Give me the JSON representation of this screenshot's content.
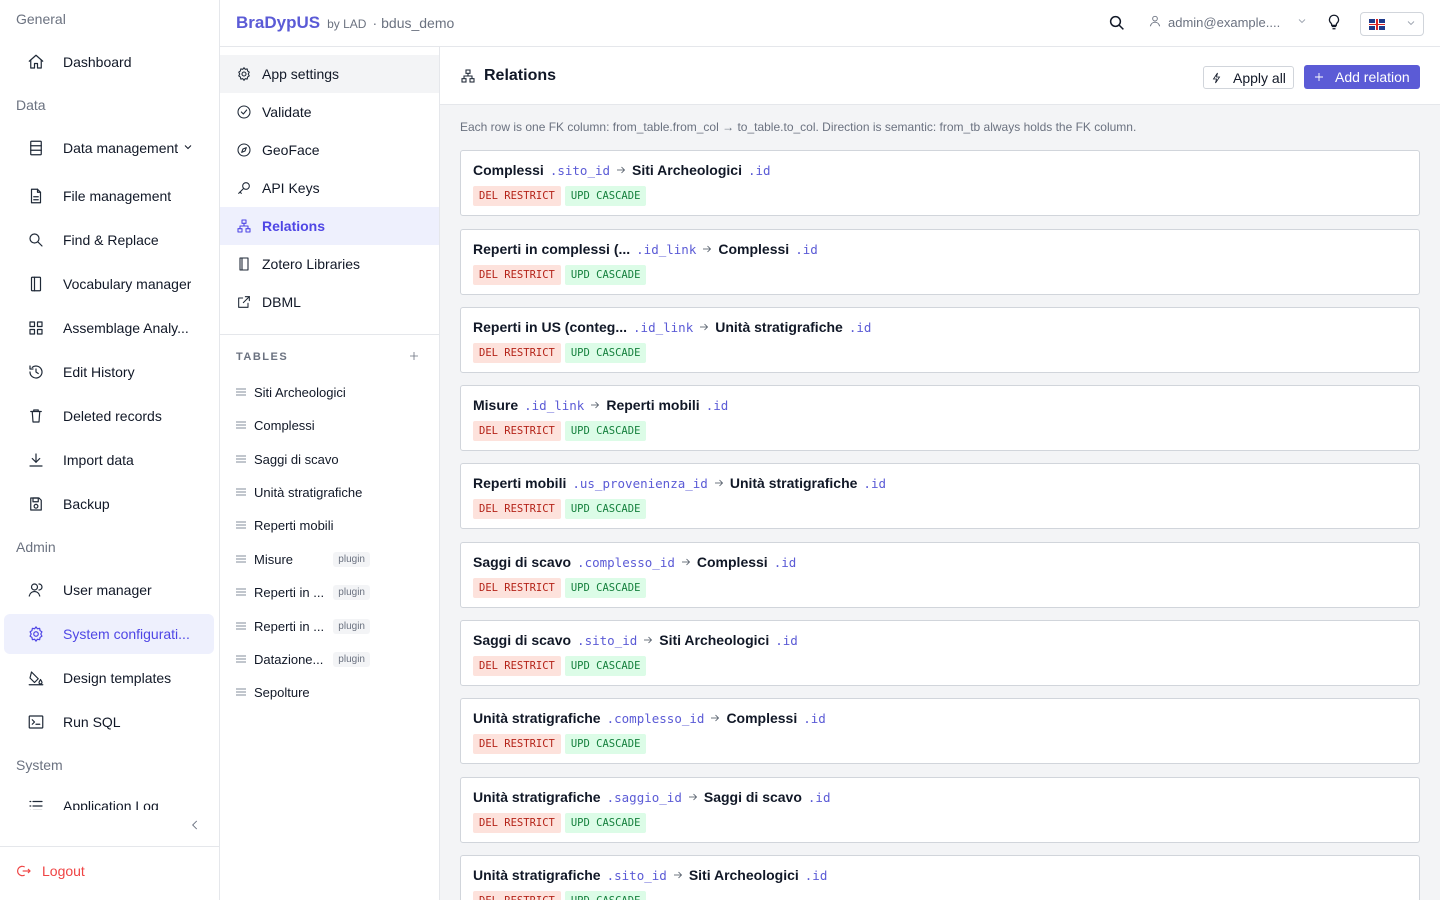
{
  "sidebar": {
    "groups": [
      "General",
      "Data",
      "Admin",
      "System"
    ],
    "items": [
      {
        "label": "Dashboard"
      },
      {
        "label": "Data management"
      },
      {
        "label": "File management"
      },
      {
        "label": "Find & Replace"
      },
      {
        "label": "Vocabulary manager"
      },
      {
        "label": "Assemblage Analy..."
      },
      {
        "label": "Edit History"
      },
      {
        "label": "Deleted records"
      },
      {
        "label": "Import data"
      },
      {
        "label": "Backup"
      },
      {
        "label": "User manager"
      },
      {
        "label": "System configurati..."
      },
      {
        "label": "Design templates"
      },
      {
        "label": "Run SQL"
      },
      {
        "label": "Application Log"
      }
    ],
    "logout": "Logout"
  },
  "header": {
    "brand": "BraDypUS",
    "by": "by LAD",
    "sep": "·",
    "db": "bdus_demo",
    "user": "admin@example...."
  },
  "submenu": {
    "items": [
      {
        "label": "App settings"
      },
      {
        "label": "Validate"
      },
      {
        "label": "GeoFace"
      },
      {
        "label": "API Keys"
      },
      {
        "label": "Relations"
      },
      {
        "label": "Zotero Libraries"
      },
      {
        "label": "DBML"
      }
    ],
    "tables_heading": "TABLES",
    "tables": [
      {
        "name": "Siti Archeologici",
        "badge": ""
      },
      {
        "name": "Complessi",
        "badge": ""
      },
      {
        "name": "Saggi di scavo",
        "badge": ""
      },
      {
        "name": "Unità stratigrafiche",
        "badge": ""
      },
      {
        "name": "Reperti mobili",
        "badge": ""
      },
      {
        "name": "Misure",
        "badge": "plugin"
      },
      {
        "name": "Reperti in ...",
        "badge": "plugin"
      },
      {
        "name": "Reperti in ...",
        "badge": "plugin"
      },
      {
        "name": "Datazione...",
        "badge": "plugin"
      },
      {
        "name": "Sepolture",
        "badge": ""
      }
    ]
  },
  "main": {
    "title": "Relations",
    "apply_all": "Apply all",
    "add_relation": "Add relation",
    "hint": "Each row is one FK column: from_table.from_col → to_table.to_col. Direction is semantic: from_tb always holds the FK column.",
    "relations": [
      {
        "from_tb": "Complessi",
        "from_col": ".sito_id",
        "to_tb": "Siti Archeologici",
        "to_col": ".id",
        "del": "DEL RESTRICT",
        "upd": "UPD CASCADE"
      },
      {
        "from_tb": "Reperti in complessi (...",
        "from_col": ".id_link",
        "to_tb": "Complessi",
        "to_col": ".id",
        "del": "DEL RESTRICT",
        "upd": "UPD CASCADE"
      },
      {
        "from_tb": "Reperti in US (conteg...",
        "from_col": ".id_link",
        "to_tb": "Unità stratigrafiche",
        "to_col": ".id",
        "del": "DEL RESTRICT",
        "upd": "UPD CASCADE"
      },
      {
        "from_tb": "Misure",
        "from_col": ".id_link",
        "to_tb": "Reperti mobili",
        "to_col": ".id",
        "del": "DEL RESTRICT",
        "upd": "UPD CASCADE"
      },
      {
        "from_tb": "Reperti mobili",
        "from_col": ".us_provenienza_id",
        "to_tb": "Unità stratigrafiche",
        "to_col": ".id",
        "del": "DEL RESTRICT",
        "upd": "UPD CASCADE"
      },
      {
        "from_tb": "Saggi di scavo",
        "from_col": ".complesso_id",
        "to_tb": "Complessi",
        "to_col": ".id",
        "del": "DEL RESTRICT",
        "upd": "UPD CASCADE"
      },
      {
        "from_tb": "Saggi di scavo",
        "from_col": ".sito_id",
        "to_tb": "Siti Archeologici",
        "to_col": ".id",
        "del": "DEL RESTRICT",
        "upd": "UPD CASCADE"
      },
      {
        "from_tb": "Unità stratigrafiche",
        "from_col": ".complesso_id",
        "to_tb": "Complessi",
        "to_col": ".id",
        "del": "DEL RESTRICT",
        "upd": "UPD CASCADE"
      },
      {
        "from_tb": "Unità stratigrafiche",
        "from_col": ".saggio_id",
        "to_tb": "Saggi di scavo",
        "to_col": ".id",
        "del": "DEL RESTRICT",
        "upd": "UPD CASCADE"
      },
      {
        "from_tb": "Unità stratigrafiche",
        "from_col": ".sito_id",
        "to_tb": "Siti Archeologici",
        "to_col": ".id",
        "del": "DEL RESTRICT",
        "upd": "UPD CASCADE"
      }
    ]
  },
  "colors": {
    "accent": "#5b5bd6",
    "danger": "#ef4444",
    "del_bg": "#fde2dc",
    "upd_bg": "#dcfce7"
  }
}
